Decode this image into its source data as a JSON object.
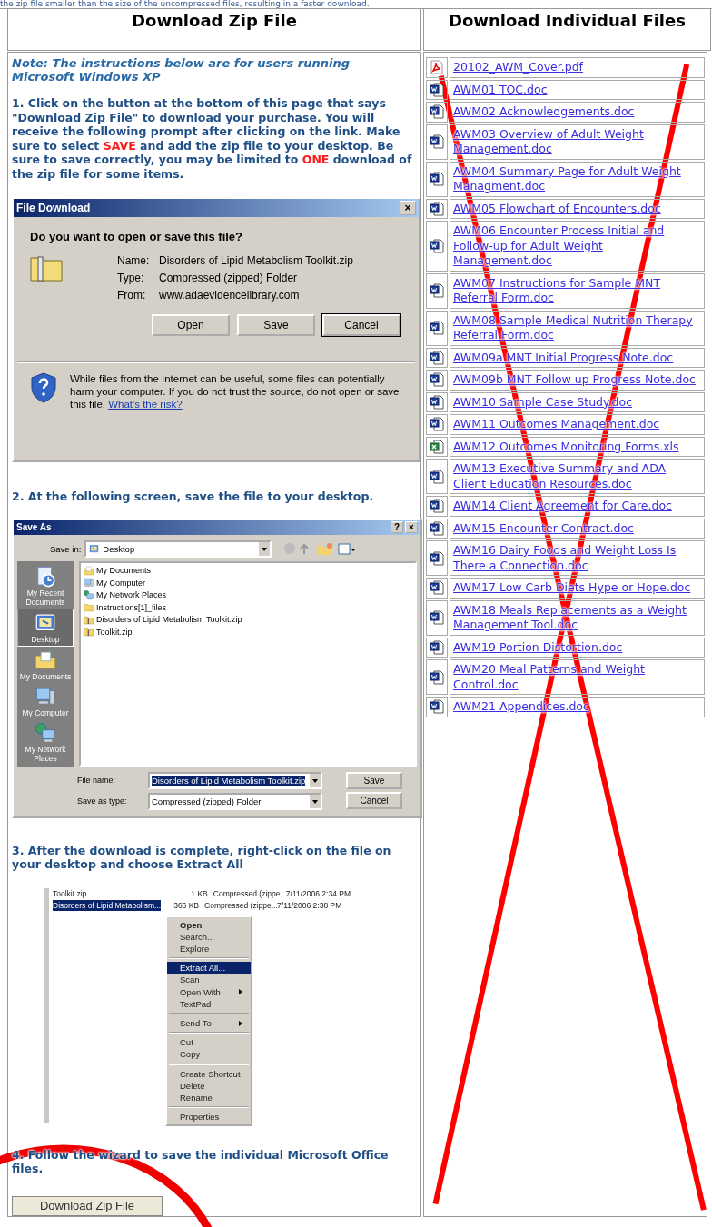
{
  "top_text": "the zip file smaller than the size of the uncompressed files, resulting in a faster download.",
  "columns": [
    {
      "heading": "Download Zip File"
    },
    {
      "heading": "Download Individual Files"
    }
  ],
  "note": "Note: The instructions below are for users running Microsoft Windows XP",
  "step1": [
    {
      "text": "1. Click on the button at the bottom of this page that says \"Download Zip File\" to download your purchase. You will receive the following prompt after clicking on the link. Make sure to select ",
      "emphasis": false
    },
    {
      "text": "SAVE",
      "emphasis": true
    },
    {
      "text": " and add the zip file to your desktop. Be sure to save correctly, you may be limited to ",
      "emphasis": false
    },
    {
      "text": "ONE",
      "emphasis": true
    },
    {
      "text": " download of the zip file for some items.",
      "emphasis": false
    }
  ],
  "file_download_dialog": {
    "title": "File Download",
    "close": "×",
    "question": "Do you want to open or save this file?",
    "fields": [
      {
        "label": "Name:",
        "value": "Disorders of Lipid Metabolism Toolkit.zip"
      },
      {
        "label": "Type:",
        "value": "Compressed (zipped) Folder"
      },
      {
        "label": "From:",
        "value": "www.adaevidencelibrary.com"
      }
    ],
    "buttons": [
      {
        "label": "Open",
        "default": false
      },
      {
        "label": "Save",
        "default": false
      },
      {
        "label": "Cancel",
        "default": true
      }
    ],
    "warning": "While files from the Internet can be useful, some files can potentially harm your computer. If you do not trust the source, do not open or save this file.",
    "warning_link": "What's the risk?"
  },
  "step2": "2. At the following screen, save the file to your desktop.",
  "save_as_dialog": {
    "title": "Save As",
    "help": "?",
    "close": "×",
    "save_in_label": "Save in:",
    "save_in_value": "Desktop",
    "places": [
      {
        "label": "My Recent Documents",
        "kind": "recent",
        "selected": false
      },
      {
        "label": "Desktop",
        "kind": "desktop",
        "selected": true
      },
      {
        "label": "My Documents",
        "kind": "documents",
        "selected": false
      },
      {
        "label": "My Computer",
        "kind": "computer",
        "selected": false
      },
      {
        "label": "My Network Places",
        "kind": "network",
        "selected": false
      }
    ],
    "files": [
      {
        "name": "My Documents",
        "kind": "documents"
      },
      {
        "name": "My Computer",
        "kind": "computer"
      },
      {
        "name": "My Network Places",
        "kind": "network"
      },
      {
        "name": "Instructions[1]_files",
        "kind": "folder"
      },
      {
        "name": "Disorders of Lipid Metabolism Toolkit.zip",
        "kind": "zip"
      },
      {
        "name": "Toolkit.zip",
        "kind": "zip"
      }
    ],
    "file_name_label": "File name:",
    "file_name_value": "Disorders of Lipid Metabolism Toolkit.zip",
    "type_label": "Save as type:",
    "type_value": "Compressed (zipped) Folder",
    "buttons": [
      {
        "label": "Save"
      },
      {
        "label": "Cancel"
      }
    ]
  },
  "step3": "3. After the download is complete, right-click on the file on your desktop and choose Extract All",
  "explorer": {
    "rows": [
      {
        "name": "Toolkit.zip",
        "size": "1 KB",
        "type": "Compressed (zippe...",
        "modified": "7/11/2006 2:34 PM",
        "selected": false
      },
      {
        "name": "Disorders of Lipid Metabolism...",
        "size": "366 KB",
        "type": "Compressed (zippe...",
        "modified": "7/11/2006 2:38 PM",
        "selected": true
      }
    ],
    "menu_groups": [
      [
        {
          "label": "Open",
          "default": true,
          "submenu": false,
          "selected": false
        },
        {
          "label": "Search...",
          "default": false,
          "submenu": false,
          "selected": false
        },
        {
          "label": "Explore",
          "default": false,
          "submenu": false,
          "selected": false
        }
      ],
      [
        {
          "label": "Extract All...",
          "default": false,
          "submenu": false,
          "selected": true
        },
        {
          "label": "Scan",
          "default": false,
          "submenu": false,
          "selected": false
        },
        {
          "label": "Open With",
          "default": false,
          "submenu": true,
          "selected": false
        },
        {
          "label": "TextPad",
          "default": false,
          "submenu": false,
          "selected": false
        }
      ],
      [
        {
          "label": "Send To",
          "default": false,
          "submenu": true,
          "selected": false
        }
      ],
      [
        {
          "label": "Cut",
          "default": false,
          "submenu": false,
          "selected": false
        },
        {
          "label": "Copy",
          "default": false,
          "submenu": false,
          "selected": false
        }
      ],
      [
        {
          "label": "Create Shortcut",
          "default": false,
          "submenu": false,
          "selected": false
        },
        {
          "label": "Delete",
          "default": false,
          "submenu": false,
          "selected": false
        },
        {
          "label": "Rename",
          "default": false,
          "submenu": false,
          "selected": false
        }
      ],
      [
        {
          "label": "Properties",
          "default": false,
          "submenu": false,
          "selected": false
        }
      ]
    ]
  },
  "step4": "4. Follow the wizard to save the individual Microsoft Office files.",
  "download_button": "Download Zip File",
  "files": [
    {
      "name": "20102_AWM_Cover.pdf",
      "kind": "pdf"
    },
    {
      "name": "AWM01 TOC.doc",
      "kind": "doc"
    },
    {
      "name": "AWM02 Acknowledgements.doc",
      "kind": "doc"
    },
    {
      "name": "AWM03 Overview of Adult Weight Management.doc",
      "kind": "doc"
    },
    {
      "name": "AWM04 Summary Page for Adult Weight Managment.doc",
      "kind": "doc"
    },
    {
      "name": "AWM05 Flowchart of Encounters.doc",
      "kind": "doc"
    },
    {
      "name": "AWM06 Encounter Process Initial and Follow-up for Adult Weight Management.doc",
      "kind": "doc"
    },
    {
      "name": "AWM07 Instructions for Sample MNT Referral Form.doc",
      "kind": "doc"
    },
    {
      "name": "AWM08 Sample Medical Nutrition Therapy Referral Form.doc",
      "kind": "doc"
    },
    {
      "name": "AWM09a MNT Initial Progress Note.doc",
      "kind": "doc"
    },
    {
      "name": "AWM09b MNT Follow up Progress Note.doc",
      "kind": "doc"
    },
    {
      "name": "AWM10 Sample Case Study.doc",
      "kind": "doc"
    },
    {
      "name": "AWM11 Outcomes Management.doc",
      "kind": "doc"
    },
    {
      "name": "AWM12 Outcomes Monitoring Forms.xls",
      "kind": "xls"
    },
    {
      "name": "AWM13 Executive Summary and ADA Client Education Resources.doc",
      "kind": "doc"
    },
    {
      "name": "AWM14 Client Agreement for Care.doc",
      "kind": "doc"
    },
    {
      "name": "AWM15 Encounter Contract.doc",
      "kind": "doc"
    },
    {
      "name": "AWM16 Dairy Foods and Weight Loss Is There a Connection.doc",
      "kind": "doc"
    },
    {
      "name": "AWM17 Low Carb Diets Hype or Hope.doc",
      "kind": "doc"
    },
    {
      "name": "AWM18 Meals Replacements as a Weight Management Tool.doc",
      "kind": "doc"
    },
    {
      "name": "AWM19 Portion Distortion.doc",
      "kind": "doc"
    },
    {
      "name": "AWM20 Meal Patterns and Weight Control.doc",
      "kind": "doc"
    },
    {
      "name": "AWM21 Appendices.doc",
      "kind": "doc"
    }
  ]
}
